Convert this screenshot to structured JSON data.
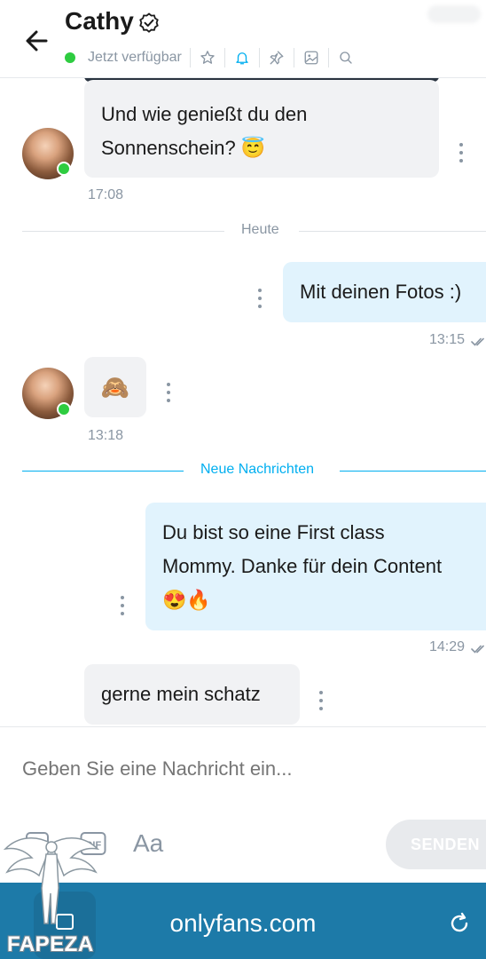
{
  "header": {
    "title": "Cathy",
    "status": "Jetzt verfügbar"
  },
  "messages": [
    {
      "direction": "in",
      "text_line1": "Und wie genießt du den",
      "text_line2": "Sonnenschein? 😇",
      "time": "17:08"
    },
    {
      "divider": "Heute"
    },
    {
      "direction": "out",
      "text": "Mit deinen Fotos :)",
      "time": "13:15"
    },
    {
      "direction": "in",
      "text": "🙈",
      "time": "13:18"
    },
    {
      "divider": "Neue Nachrichten"
    },
    {
      "direction": "out",
      "text_line1": "Du bist so eine First class",
      "text_line2": "Mommy. Danke für dein Content",
      "text_line3": "😍🔥",
      "time": "14:29"
    },
    {
      "direction": "in",
      "text": "gerne mein schatz"
    }
  ],
  "composer": {
    "placeholder": "Geben Sie eine Nachricht ein...",
    "text_tool": "Aa",
    "send_label": "SENDEN"
  },
  "browser": {
    "url": "onlyfans.com"
  },
  "watermark": "FAPEZA",
  "colors": {
    "online": "#2ecc40",
    "accent": "#00aff0",
    "incoming_bubble": "#f1f2f4",
    "outgoing_bubble": "#e1f3fd",
    "browser_bar": "#1d7aa8"
  }
}
